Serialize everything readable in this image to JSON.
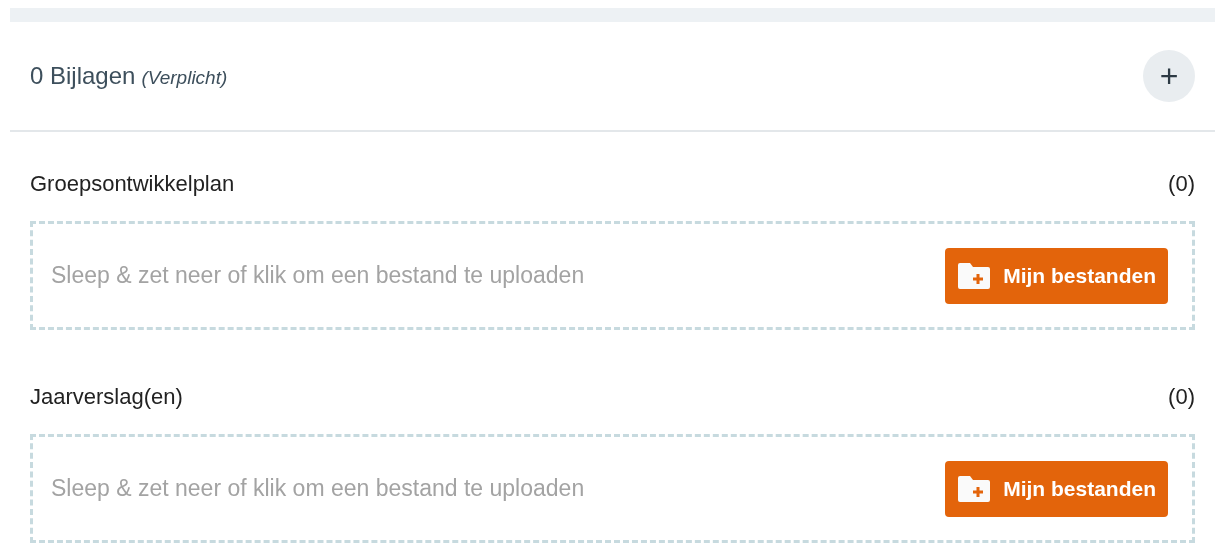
{
  "header": {
    "title": "0 Bijlagen",
    "note": "(Verplicht)",
    "add_button": "+"
  },
  "sections": [
    {
      "label": "Groepsontwikkelplan",
      "count": "(0)",
      "dropzone_text": "Sleep & zet neer of klik om een bestand te uploaden",
      "button": "Mijn bestanden"
    },
    {
      "label": "Jaarverslag(en)",
      "count": "(0)",
      "dropzone_text": "Sleep & zet neer of klik om een bestand te uploaden",
      "button": "Mijn bestanden"
    }
  ]
}
